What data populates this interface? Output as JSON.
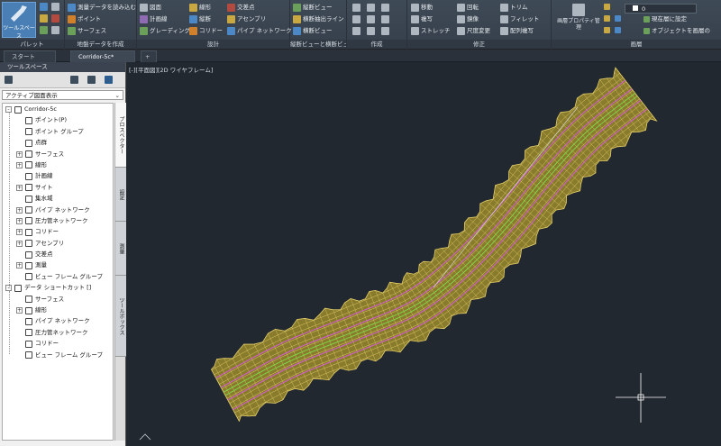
{
  "ribbon": {
    "toolspace_label": "ツールスペース",
    "groups": [
      {
        "title": "パレット",
        "items": []
      },
      {
        "title": "地盤データを作成",
        "items": [
          "測量データを読み込む",
          "ポイント",
          "サーフェス"
        ]
      },
      {
        "title": "設計",
        "items": [
          "図面",
          "計画線",
          "グレーディング",
          "線形",
          "縦断",
          "コリドー",
          "交差点",
          "アセンブリ",
          "パイプ ネットワーク"
        ]
      },
      {
        "title": "縦断ビューと横断ビュー",
        "items": [
          "縦断ビュー",
          "横断抽出ライン",
          "横断ビュー"
        ]
      },
      {
        "title": "作成",
        "items": []
      },
      {
        "title": "修正",
        "items": [
          "移動",
          "複写",
          "ストレッチ",
          "回転",
          "鏡像",
          "尺度変更",
          "トリム",
          "フィレット",
          "配列複写"
        ]
      },
      {
        "title": "画層",
        "items": [
          "画層プロパティ管理",
          "現在層に設定",
          "オブジェクトを画層の"
        ]
      }
    ],
    "layer_value": "0"
  },
  "tabs": {
    "start": "スタート",
    "document": "Corridor-5c*",
    "new_tab": "+"
  },
  "palette": {
    "title": "ツールスペース",
    "view_select": "アクティブ図面表示",
    "side_tabs": [
      "プロスペクター",
      "設定",
      "測量",
      "ツールボックス"
    ],
    "tree": [
      {
        "label": "Corridor-5c",
        "level": 0,
        "expand": "-",
        "icon": "drawing-icon"
      },
      {
        "label": "ポイント(P)",
        "level": 1,
        "expand": "",
        "icon": "point-icon"
      },
      {
        "label": "ポイント グループ",
        "level": 1,
        "expand": "",
        "icon": "point-group-icon"
      },
      {
        "label": "点群",
        "level": 1,
        "expand": "",
        "icon": "point-cloud-icon"
      },
      {
        "label": "サーフェス",
        "level": 1,
        "expand": "+",
        "icon": "surface-icon"
      },
      {
        "label": "線形",
        "level": 1,
        "expand": "+",
        "icon": "alignment-icon"
      },
      {
        "label": "計画線",
        "level": 1,
        "expand": "",
        "icon": "feature-line-icon"
      },
      {
        "label": "サイト",
        "level": 1,
        "expand": "+",
        "icon": "site-icon"
      },
      {
        "label": "集水域",
        "level": 1,
        "expand": "",
        "icon": "catchment-icon"
      },
      {
        "label": "パイプ ネットワーク",
        "level": 1,
        "expand": "+",
        "icon": "pipe-network-icon"
      },
      {
        "label": "圧力管ネットワーク",
        "level": 1,
        "expand": "+",
        "icon": "pressure-network-icon"
      },
      {
        "label": "コリドー",
        "level": 1,
        "expand": "+",
        "icon": "corridor-icon"
      },
      {
        "label": "アセンブリ",
        "level": 1,
        "expand": "+",
        "icon": "assembly-icon"
      },
      {
        "label": "交差点",
        "level": 1,
        "expand": "",
        "icon": "intersection-icon"
      },
      {
        "label": "測量",
        "level": 1,
        "expand": "+",
        "icon": "survey-icon"
      },
      {
        "label": "ビュー フレーム グループ",
        "level": 1,
        "expand": "",
        "icon": "view-frame-icon"
      },
      {
        "label": "データ ショートカット []",
        "level": 0,
        "expand": "-",
        "icon": "data-shortcut-icon"
      },
      {
        "label": "サーフェス",
        "level": 1,
        "expand": "",
        "icon": "surface-icon"
      },
      {
        "label": "線形",
        "level": 1,
        "expand": "+",
        "icon": "alignment-icon"
      },
      {
        "label": "パイプ ネットワーク",
        "level": 1,
        "expand": "",
        "icon": "pipe-network-icon"
      },
      {
        "label": "圧力管ネットワーク",
        "level": 1,
        "expand": "",
        "icon": "pressure-network-icon"
      },
      {
        "label": "コリドー",
        "level": 1,
        "expand": "",
        "icon": "corridor-icon"
      },
      {
        "label": "ビュー フレーム グループ",
        "level": 1,
        "expand": "",
        "icon": "view-frame-icon"
      }
    ]
  },
  "viewport": {
    "label": "[-][平面図][2D ワイヤフレーム]"
  },
  "colors": {
    "background": "#212830",
    "corridor_fill": "#9a8a2c",
    "corridor_mesh": "#e8d06a",
    "centerline": "#7ddc4a",
    "baseline": "#d85ad8"
  }
}
